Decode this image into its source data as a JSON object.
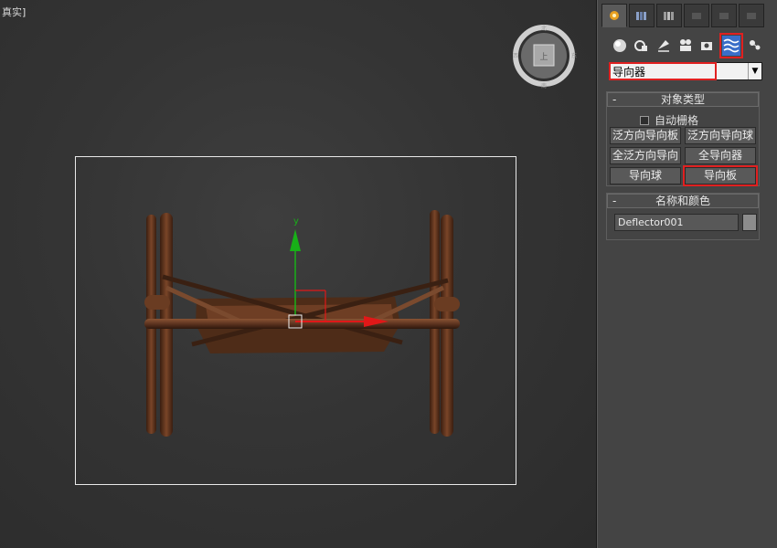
{
  "viewport": {
    "label_bracket_open": "",
    "label": "真实",
    "label_bracket_close": "]"
  },
  "viewcube": {
    "north": "北",
    "south": "南",
    "west": "西",
    "east": "东",
    "face": "上"
  },
  "gizmo": {
    "y_label": "y",
    "colors": {
      "y": "#18b018",
      "x": "#e01818"
    }
  },
  "panel": {
    "tabs": [
      "create-tab",
      "modify-tab",
      "hierarchy-tab",
      "motion-tab",
      "display-tab",
      "utilities-tab"
    ],
    "subicons": [
      "geometry-icon",
      "shapes-icon",
      "lights-icon",
      "cameras-icon",
      "helpers-icon",
      "space-warps-icon",
      "systems-icon"
    ],
    "category_dropdown": {
      "value": "导向器",
      "arrow": "▼"
    },
    "object_type": {
      "header": "对象类型",
      "collapse": "-",
      "autogrid_label": "自动栅格",
      "buttons": [
        "泛方向导向板",
        "泛方向导向球",
        "全泛方向导向",
        "全导向器",
        "导向球",
        "导向板"
      ]
    },
    "name_color": {
      "header": "名称和颜色",
      "collapse": "-",
      "name_value": "Deflector001",
      "swatch_color": "#8c8c8c"
    },
    "highlight_color": "#e02020"
  }
}
